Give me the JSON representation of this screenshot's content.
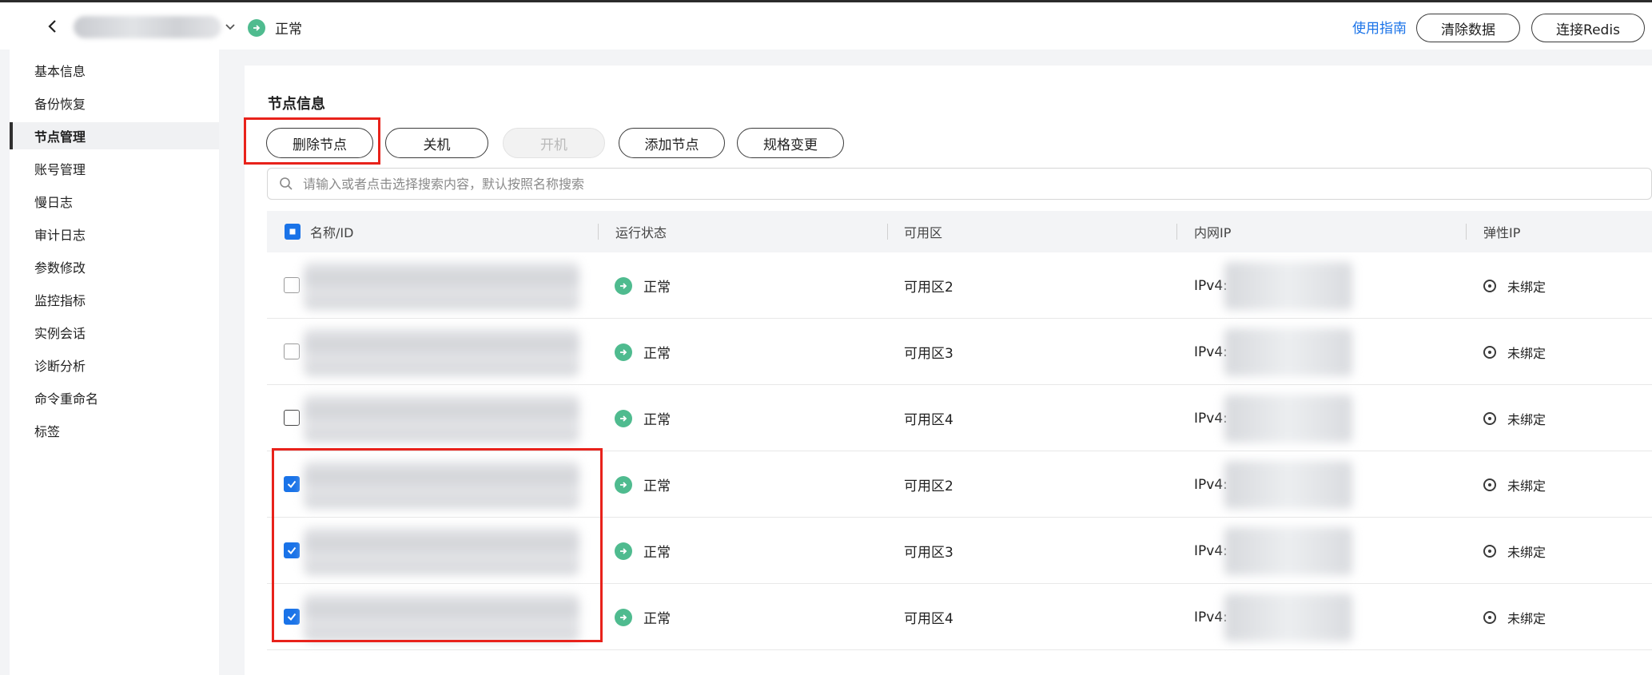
{
  "header": {
    "status": "正常",
    "guide_link": "使用指南",
    "btn_clear": "清除数据",
    "btn_connect": "连接Redis"
  },
  "sidebar": {
    "items": [
      {
        "label": "基本信息"
      },
      {
        "label": "备份恢复"
      },
      {
        "label": "节点管理",
        "active": true
      },
      {
        "label": "账号管理"
      },
      {
        "label": "慢日志"
      },
      {
        "label": "审计日志"
      },
      {
        "label": "参数修改"
      },
      {
        "label": "监控指标"
      },
      {
        "label": "实例会话"
      },
      {
        "label": "诊断分析"
      },
      {
        "label": "命令重命名"
      },
      {
        "label": "标签"
      }
    ]
  },
  "nodes": {
    "title": "节点信息",
    "actions": {
      "delete": "删除节点",
      "shutdown": "关机",
      "start": "开机",
      "add": "添加节点",
      "resize": "规格变更"
    },
    "search_placeholder": "请输入或者点击选择搜索内容，默认按照名称搜索",
    "columns": {
      "name": "名称/ID",
      "status": "运行状态",
      "zone": "可用区",
      "ip": "内网IP",
      "eip": "弹性IP"
    },
    "rows": [
      {
        "status": "正常",
        "zone": "可用区2",
        "ip": "IPv4:",
        "eip": "未绑定",
        "checked": false
      },
      {
        "status": "正常",
        "zone": "可用区3",
        "ip": "IPv4:",
        "eip": "未绑定",
        "checked": false
      },
      {
        "status": "正常",
        "zone": "可用区4",
        "ip": "IPv4:",
        "eip": "未绑定",
        "checked": false
      },
      {
        "status": "正常",
        "zone": "可用区2",
        "ip": "IPv4:",
        "eip": "未绑定",
        "checked": true
      },
      {
        "status": "正常",
        "zone": "可用区3",
        "ip": "IPv4:",
        "eip": "未绑定",
        "checked": true
      },
      {
        "status": "正常",
        "zone": "可用区4",
        "ip": "IPv4:",
        "eip": "未绑定",
        "checked": true
      }
    ]
  },
  "colors": {
    "accent": "#1a73e8",
    "status_ok": "#4fbb8f",
    "highlight": "#e8221b"
  }
}
